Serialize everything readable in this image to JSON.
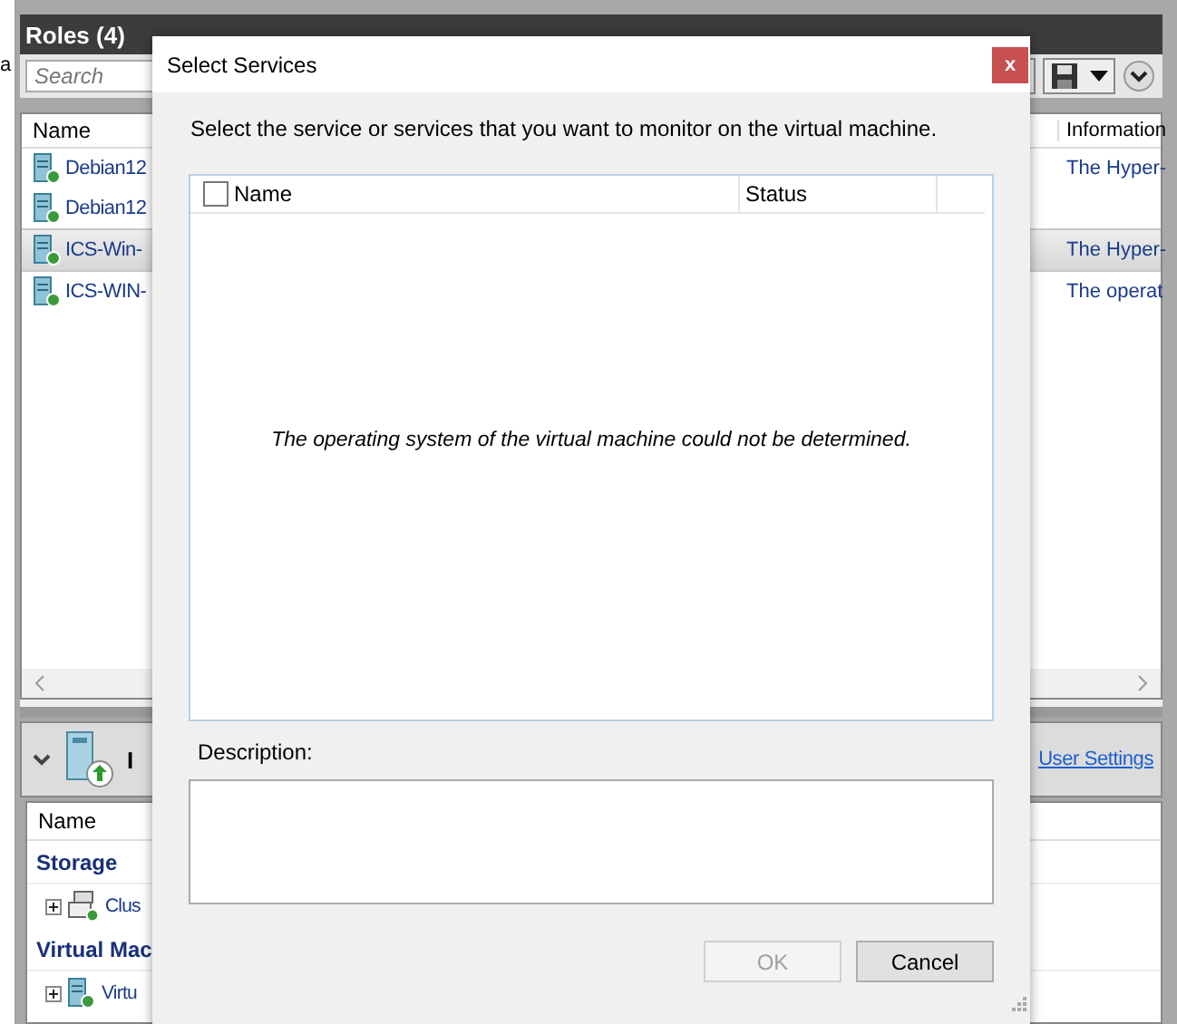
{
  "left_pane": {
    "edge_text": "a"
  },
  "roles": {
    "title": "Roles (4)",
    "search": {
      "placeholder": "Search"
    },
    "columns": [
      "Name",
      "Information"
    ],
    "rows": [
      {
        "name": "Debian12",
        "information": "The Hyper-",
        "selected": false
      },
      {
        "name": "Debian12",
        "selected": false
      },
      {
        "name": "ICS-Win-",
        "information": "The Hyper-",
        "selected": true
      },
      {
        "name": "ICS-WIN-",
        "information": "The operat",
        "selected": false
      }
    ]
  },
  "details": {
    "title": "I",
    "link": "User Settings",
    "column": "Name",
    "groups": [
      {
        "name": "Storage",
        "items": [
          {
            "name": "Clus",
            "kind": "cluster"
          }
        ]
      },
      {
        "name": "Virtual Mac",
        "items": [
          {
            "name": "Virtu",
            "kind": "vm"
          }
        ]
      }
    ]
  },
  "dialog": {
    "title": "Select Services",
    "close": "x",
    "instruction": "Select the service or services that you want to monitor on the virtual machine.",
    "columns": [
      "Name",
      "Status"
    ],
    "select_all_checked": false,
    "empty_message": "The operating system of the virtual machine could not be determined.",
    "description_label": "Description:",
    "buttons": [
      {
        "label": "OK",
        "disabled": true
      },
      {
        "label": "Cancel",
        "disabled": false
      }
    ]
  }
}
